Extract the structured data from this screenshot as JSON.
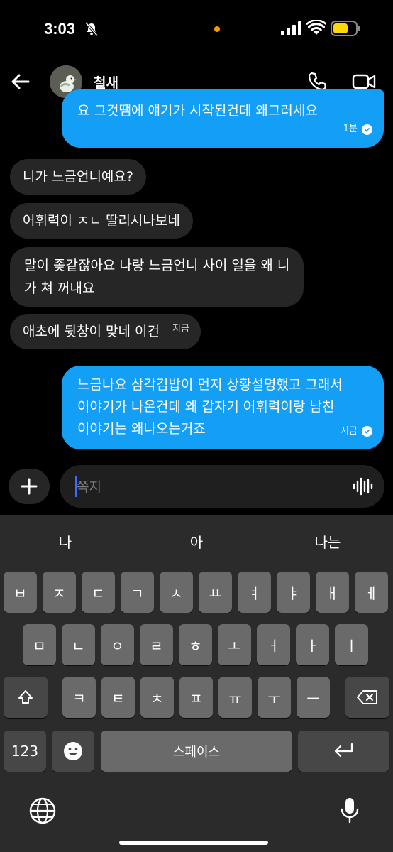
{
  "status_bar": {
    "time": "3:03"
  },
  "header": {
    "contact_name": "철새"
  },
  "messages": [
    {
      "dir": "out",
      "text": "요 그것땜에 얘기가 시작된건데  왜그러세요",
      "time": "1분"
    },
    {
      "dir": "in",
      "text": "니가 느금언니예요?"
    },
    {
      "dir": "in",
      "text": "어휘력이 ㅈㄴ 딸리시나보네"
    },
    {
      "dir": "in",
      "lines": [
        "말이 좆같잖아요 나랑 느금언니 사이 일을 왜 니",
        "가 쳐 꺼내요"
      ]
    },
    {
      "dir": "in",
      "text": "애초에 뒷창이 맞네 이건",
      "time": "지금"
    },
    {
      "dir": "out",
      "lines": [
        "느금나요 삼각김밥이 먼저 상황설명했고 그래서",
        "이야기가 나온건데 왜 갑자기 어휘력이랑 남친",
        "이야기는 왜나오는거죠"
      ],
      "time": "지금"
    }
  ],
  "composer": {
    "placeholder": "쪽지"
  },
  "keyboard": {
    "suggestions": [
      "나",
      "아",
      "나는"
    ],
    "row1": [
      "ㅂ",
      "ㅈ",
      "ㄷ",
      "ㄱ",
      "ㅅ",
      "ㅛ",
      "ㅕ",
      "ㅑ",
      "ㅐ",
      "ㅔ"
    ],
    "row2": [
      "ㅁ",
      "ㄴ",
      "ㅇ",
      "ㄹ",
      "ㅎ",
      "ㅗ",
      "ㅓ",
      "ㅏ",
      "ㅣ"
    ],
    "row3": [
      "ㅋ",
      "ㅌ",
      "ㅊ",
      "ㅍ",
      "ㅠ",
      "ㅜ",
      "ㅡ"
    ],
    "numbers_label": "123",
    "space_label": "스페이스"
  },
  "colors": {
    "outgoing_bubble": "#139ff5",
    "incoming_bubble": "#262626",
    "keyboard_bg": "#2b2b2b"
  }
}
